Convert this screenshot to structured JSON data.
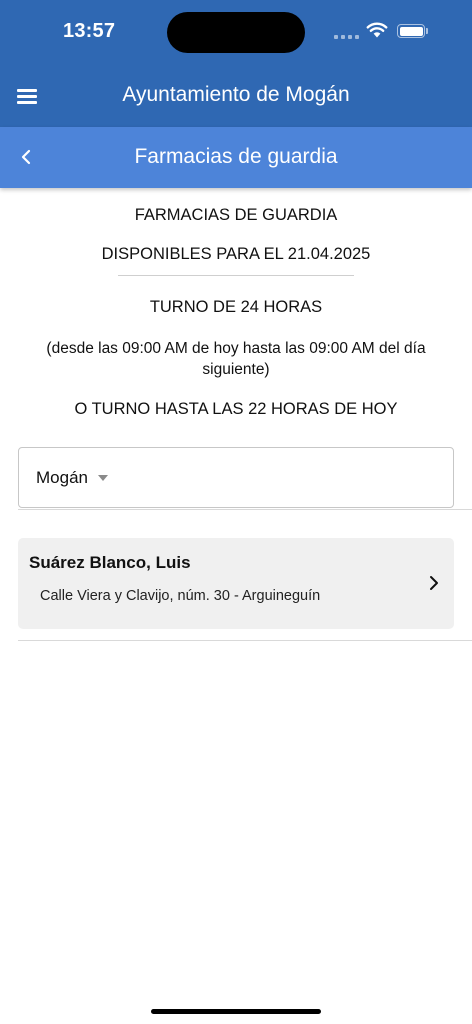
{
  "status_bar": {
    "time": "13:57"
  },
  "header": {
    "app_title": "Ayuntamiento de Mogán",
    "menu_icon": "hamburger-menu-icon"
  },
  "subheader": {
    "title": "Farmacias de guardia",
    "back_icon": "chevron-left-icon"
  },
  "info": {
    "heading": "FARMACIAS DE GUARDIA",
    "date_line": "DISPONIBLES PARA EL 21.04.2025",
    "shift_24h": "TURNO DE 24 HORAS",
    "shift_hours": "(desde las 09:00 AM de hoy hasta las 09:00 AM del día siguiente)",
    "shift_22h": "O TURNO HASTA LAS 22 HORAS DE HOY"
  },
  "municipality_select": {
    "value": "Mogán",
    "icon": "caret-down-icon"
  },
  "pharmacies": [
    {
      "name": "Suárez Blanco, Luis",
      "address": "Calle Viera y Clavijo, núm. 30 - Arguineguín",
      "icon": "chevron-right-icon"
    }
  ],
  "colors": {
    "header_bg": "#2f68b3",
    "subheader_bg": "#4d84d9",
    "card_bg": "#f0f0f0"
  }
}
